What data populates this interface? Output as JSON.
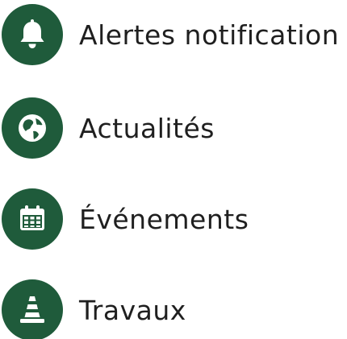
{
  "colors": {
    "accent": "#1f5b3b",
    "icon_foreground": "#ffffff",
    "text": "#1f1f1f"
  },
  "menu": {
    "items": [
      {
        "label": "Alertes notification",
        "icon": "bell-icon"
      },
      {
        "label": "Actualités",
        "icon": "globe-icon"
      },
      {
        "label": "Événements",
        "icon": "calendar-icon"
      },
      {
        "label": "Travaux",
        "icon": "traffic-cone-icon"
      }
    ]
  }
}
